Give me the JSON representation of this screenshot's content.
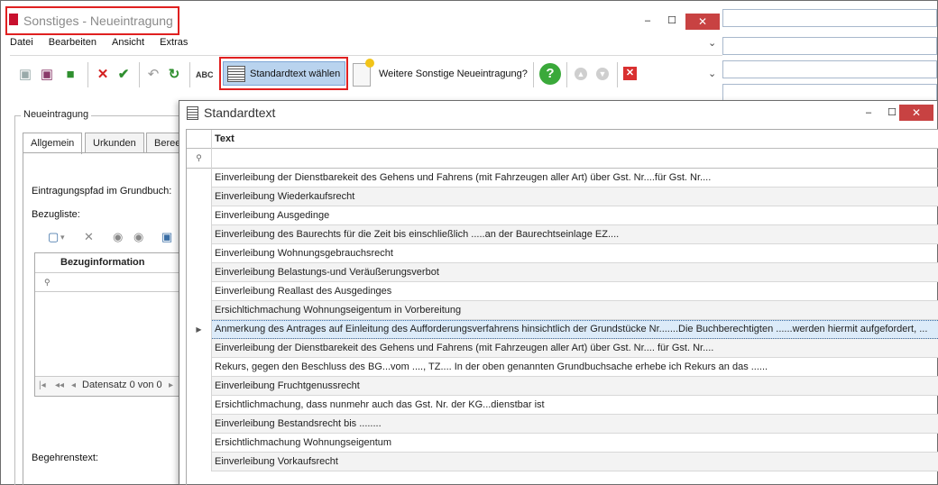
{
  "window": {
    "title": "Sonstiges - Neueintragung",
    "minimize": "–",
    "maximize": "☐",
    "close": "✕"
  },
  "menu": [
    "Datei",
    "Bearbeiten",
    "Ansicht",
    "Extras"
  ],
  "toolbar": {
    "standardtext_label": "Standardtext wählen",
    "weitere_label": "Weitere Sonstige Neueintragung?",
    "help": "?"
  },
  "main": {
    "groupbox_label": "Neueintragung",
    "tabs": [
      "Allgemein",
      "Urkunden",
      "Beree"
    ],
    "eintragungspfad_label": "Eintragungspfad im Grundbuch:",
    "bezugliste_label": "Bezugliste:",
    "bezug_column": "Bezuginformation",
    "nav_label": "Datensatz 0 von 0",
    "begehrenstext_label": "Begehrenstext:"
  },
  "dialog": {
    "title": "Standardtext",
    "column": "Text",
    "rows": [
      "Einverleibung der Dienstbarekeit des Gehens und Fahrens (mit Fahrzeugen aller Art) über Gst. Nr....für Gst. Nr....",
      "Einverleibung Wiederkaufsrecht",
      "Einverleibung Ausgedinge",
      "Einverleibung des Baurechts für die Zeit bis einschließlich .....an der Baurechtseinlage EZ....",
      "Einverleibung Wohnungsgebrauchsrecht",
      "Einverleibung Belastungs-und Veräußerungsverbot",
      "Einverleibung Reallast des Ausgedinges",
      "Ersichltichmachung Wohnungseigentum in Vorbereitung",
      "Anmerkung des Antrages auf Einleitung des Aufforderungsverfahrens hinsichtlich der Grundstücke Nr.......Die Buchberechtigten ......werden hiermit aufgefordert, ...",
      "Einverleibung der Dienstbarekeit des Gehens und Fahrens (mit Fahrzeugen aller Art) über Gst. Nr.... für Gst. Nr....",
      "Rekurs, gegen den Beschluss des BG...vom ...., TZ.... In der oben genannten Grundbuchsache erhebe ich Rekurs an das ......",
      "Einverleibung Fruchtgenussrecht",
      "Ersichtlichmachung, dass nunmehr auch das Gst. Nr.  der KG...dienstbar ist",
      "Einverleibung Bestandsrecht bis ........",
      "Ersichtlichmachung Wohnungseigentum",
      "Einverleibung Vorkaufsrecht"
    ],
    "selected_index": 8
  }
}
